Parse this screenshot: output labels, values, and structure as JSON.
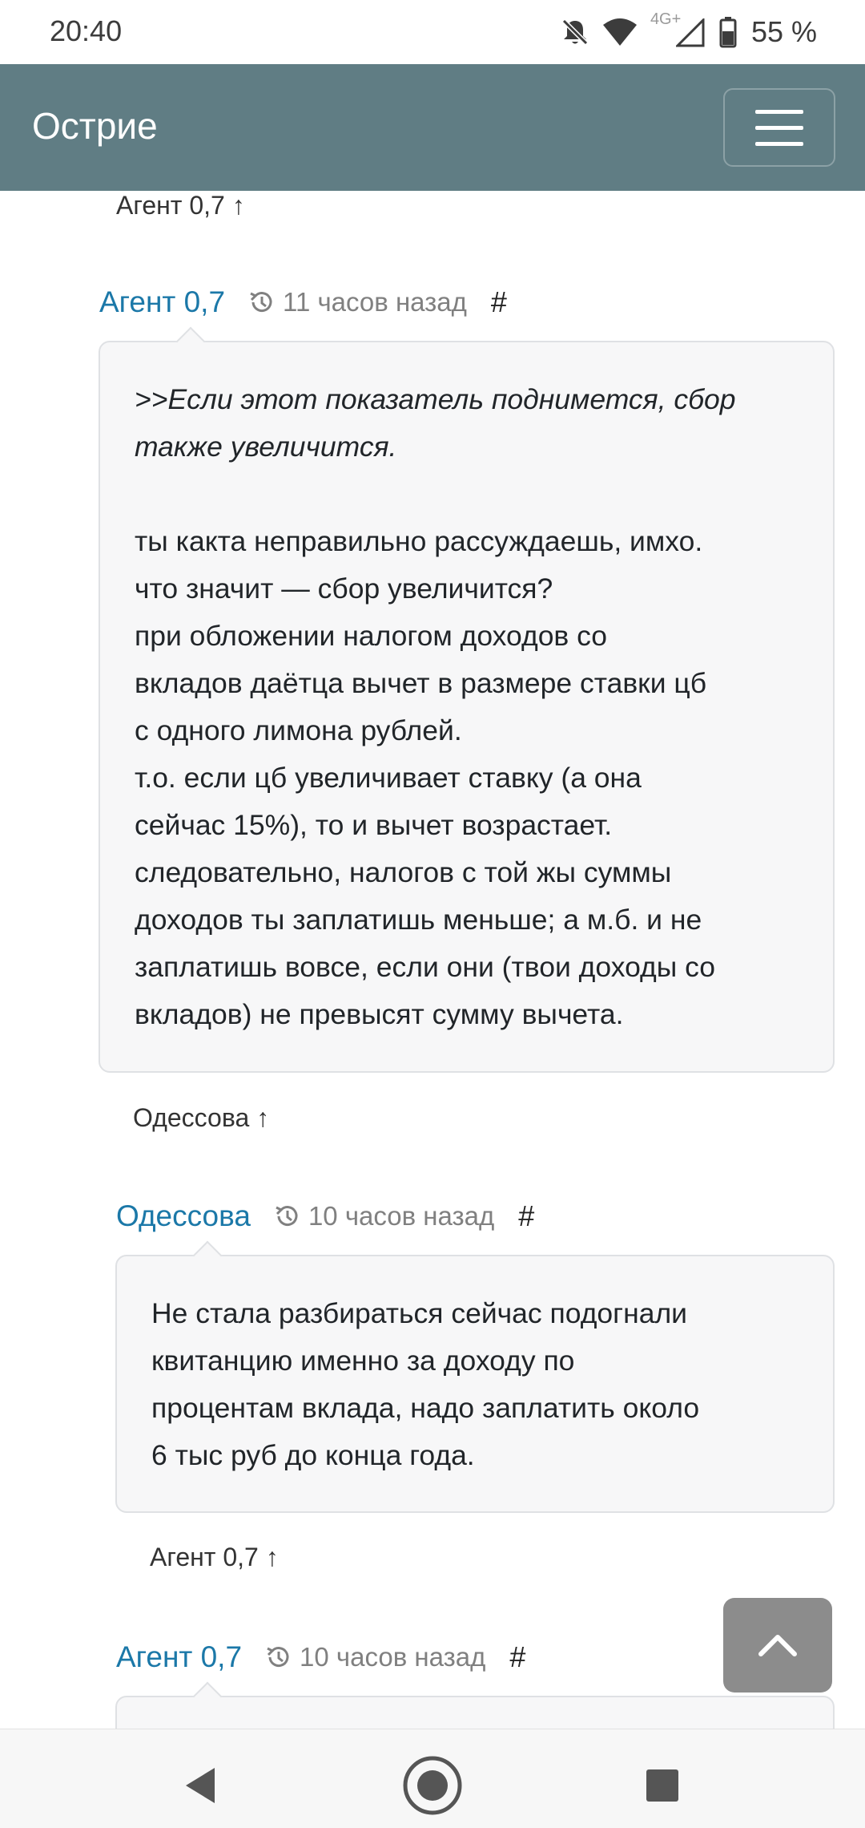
{
  "status_bar": {
    "time": "20:40",
    "network_label": "4G+",
    "battery_text": "55 %",
    "icons": [
      "mute-icon",
      "wifi-icon",
      "signal-icon",
      "battery-icon"
    ]
  },
  "navbar": {
    "brand": "Острие",
    "menu_icon": "hamburger-icon"
  },
  "comments": [
    {
      "reply_ref": "Агент 0,7 ↑",
      "author": "Агент 0,7",
      "time": "11 часов назад",
      "anchor": "#",
      "lines_quote": [
        ">>Если этот показатель поднимется, сбор",
        "также увеличится."
      ],
      "lines": [
        "ты какта неправильно рассуждаешь, имхо.",
        "что значит — сбор увеличится?",
        "при обложении налогом доходов со",
        "вкладов даётца вычет в размере ставки цб",
        "с одного лимона рублей.",
        "т.о. если цб увеличивает ставку (а она",
        "сейчас 15%), то и вычет возрастает.",
        "следовательно, налогов с той жы суммы",
        "доходов ты заплатишь меньше; а м.б. и не",
        "заплатишь вовсе, если они (твои доходы со",
        "вкладов) не превысят сумму вычета."
      ]
    },
    {
      "reply_ref": "Одессова ↑",
      "author": "Одессова",
      "time": "10 часов назад",
      "anchor": "#",
      "lines": [
        "Не стала разбираться сейчас подогнали",
        "квитанцию именно за доходу по",
        "процентам вклада, надо заплатить около",
        "6 тыс руб до конца года."
      ]
    },
    {
      "reply_ref": "Агент 0,7 ↑",
      "author": "Агент 0,7",
      "time": "10 часов назад",
      "anchor": "#"
    }
  ],
  "scroll_top_icon": "chevron-up-icon",
  "bottom_nav": {
    "back_icon": "back-triangle-icon",
    "home_icon": "home-circle-icon",
    "recents_icon": "recents-square-icon"
  }
}
